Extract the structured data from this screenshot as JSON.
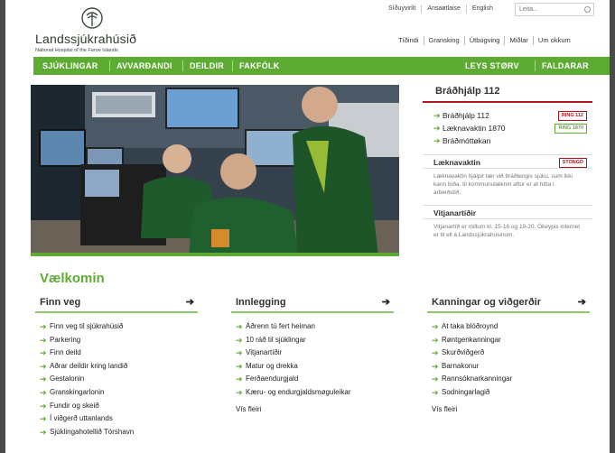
{
  "header": {
    "logo_name": "Landssjúkrahúsið",
    "logo_sub": "National Hospital of the Faroe Islands",
    "utility_links": [
      "Síðuyvirlit",
      "Ansaøtlaise",
      "English"
    ],
    "search_placeholder": "Leita...",
    "top_nav": [
      "Tíðindi",
      "Gransking",
      "Útbúgving",
      "Miðlar",
      "Um okkum"
    ]
  },
  "main_nav": {
    "left": [
      "SJÚKLINGAR",
      "AVVARÐANDI",
      "DEILDIR",
      "FAKFÓLK"
    ],
    "right": [
      "LEYS STØRV",
      "FALDARAR"
    ]
  },
  "colors": {
    "accent": "#5eab33",
    "alert": "#b0161e",
    "text": "#333333"
  },
  "emergency": {
    "title": "Bráðhjálp 112",
    "items": [
      {
        "label": "Bráðhjálp 112",
        "badge": "RING 112",
        "badge_color": "#b0161e"
      },
      {
        "label": "Læknavaktin 1870",
        "badge": "RING 1870",
        "badge_color": "#5eab33"
      },
      {
        "label": "Bráðmóttøkan",
        "badge": "",
        "badge_color": ""
      }
    ],
    "doctor_title": "Læknavaktin",
    "doctor_badge": "STONGD",
    "doctor_text": "Læknavaktin hjálpir tær við bráðtengis sjúku, sum ikki kann bíða, til kommunulæknin aftur er at hitta í arbeiðstíð.",
    "visiting_title": "Vitjanartíðir",
    "visiting_text": "Vitjanartíð er millum kl. 15-16 og 19-20. Ókeypis internet er til ell á Landssjúkrahúsinum."
  },
  "welcome": "Vælkomin",
  "columns": [
    {
      "title": "Finn veg",
      "links": [
        "Finn veg til sjúkrahúsið",
        "Parkering",
        "Finn deild",
        "Aðrar deildir kring landið",
        "Gestalonin",
        "Granskingarlonin",
        "Fundir og skeið",
        "Í viðgerð uttanlands",
        "Sjúklingahotellið Tórshavn"
      ],
      "more": ""
    },
    {
      "title": "Innlegging",
      "links": [
        "Áðrenn tú fert heiman",
        "10 ráð til sjúklingar",
        "Vitjanartíðir",
        "Matur og drekka",
        "Ferðaendurgjald",
        "Kæru- og endurgjaldsmøguleikar"
      ],
      "more": "Vís fleiri"
    },
    {
      "title": "Kanningar og viðgerðir",
      "links": [
        "At taka blóðroynd",
        "Røntgenkanningar",
        "Skurðviðgerð",
        "Barnakonur",
        "Rannsóknarkanningar",
        "Sodningarlagið"
      ],
      "more": "Vís fleiri"
    }
  ]
}
